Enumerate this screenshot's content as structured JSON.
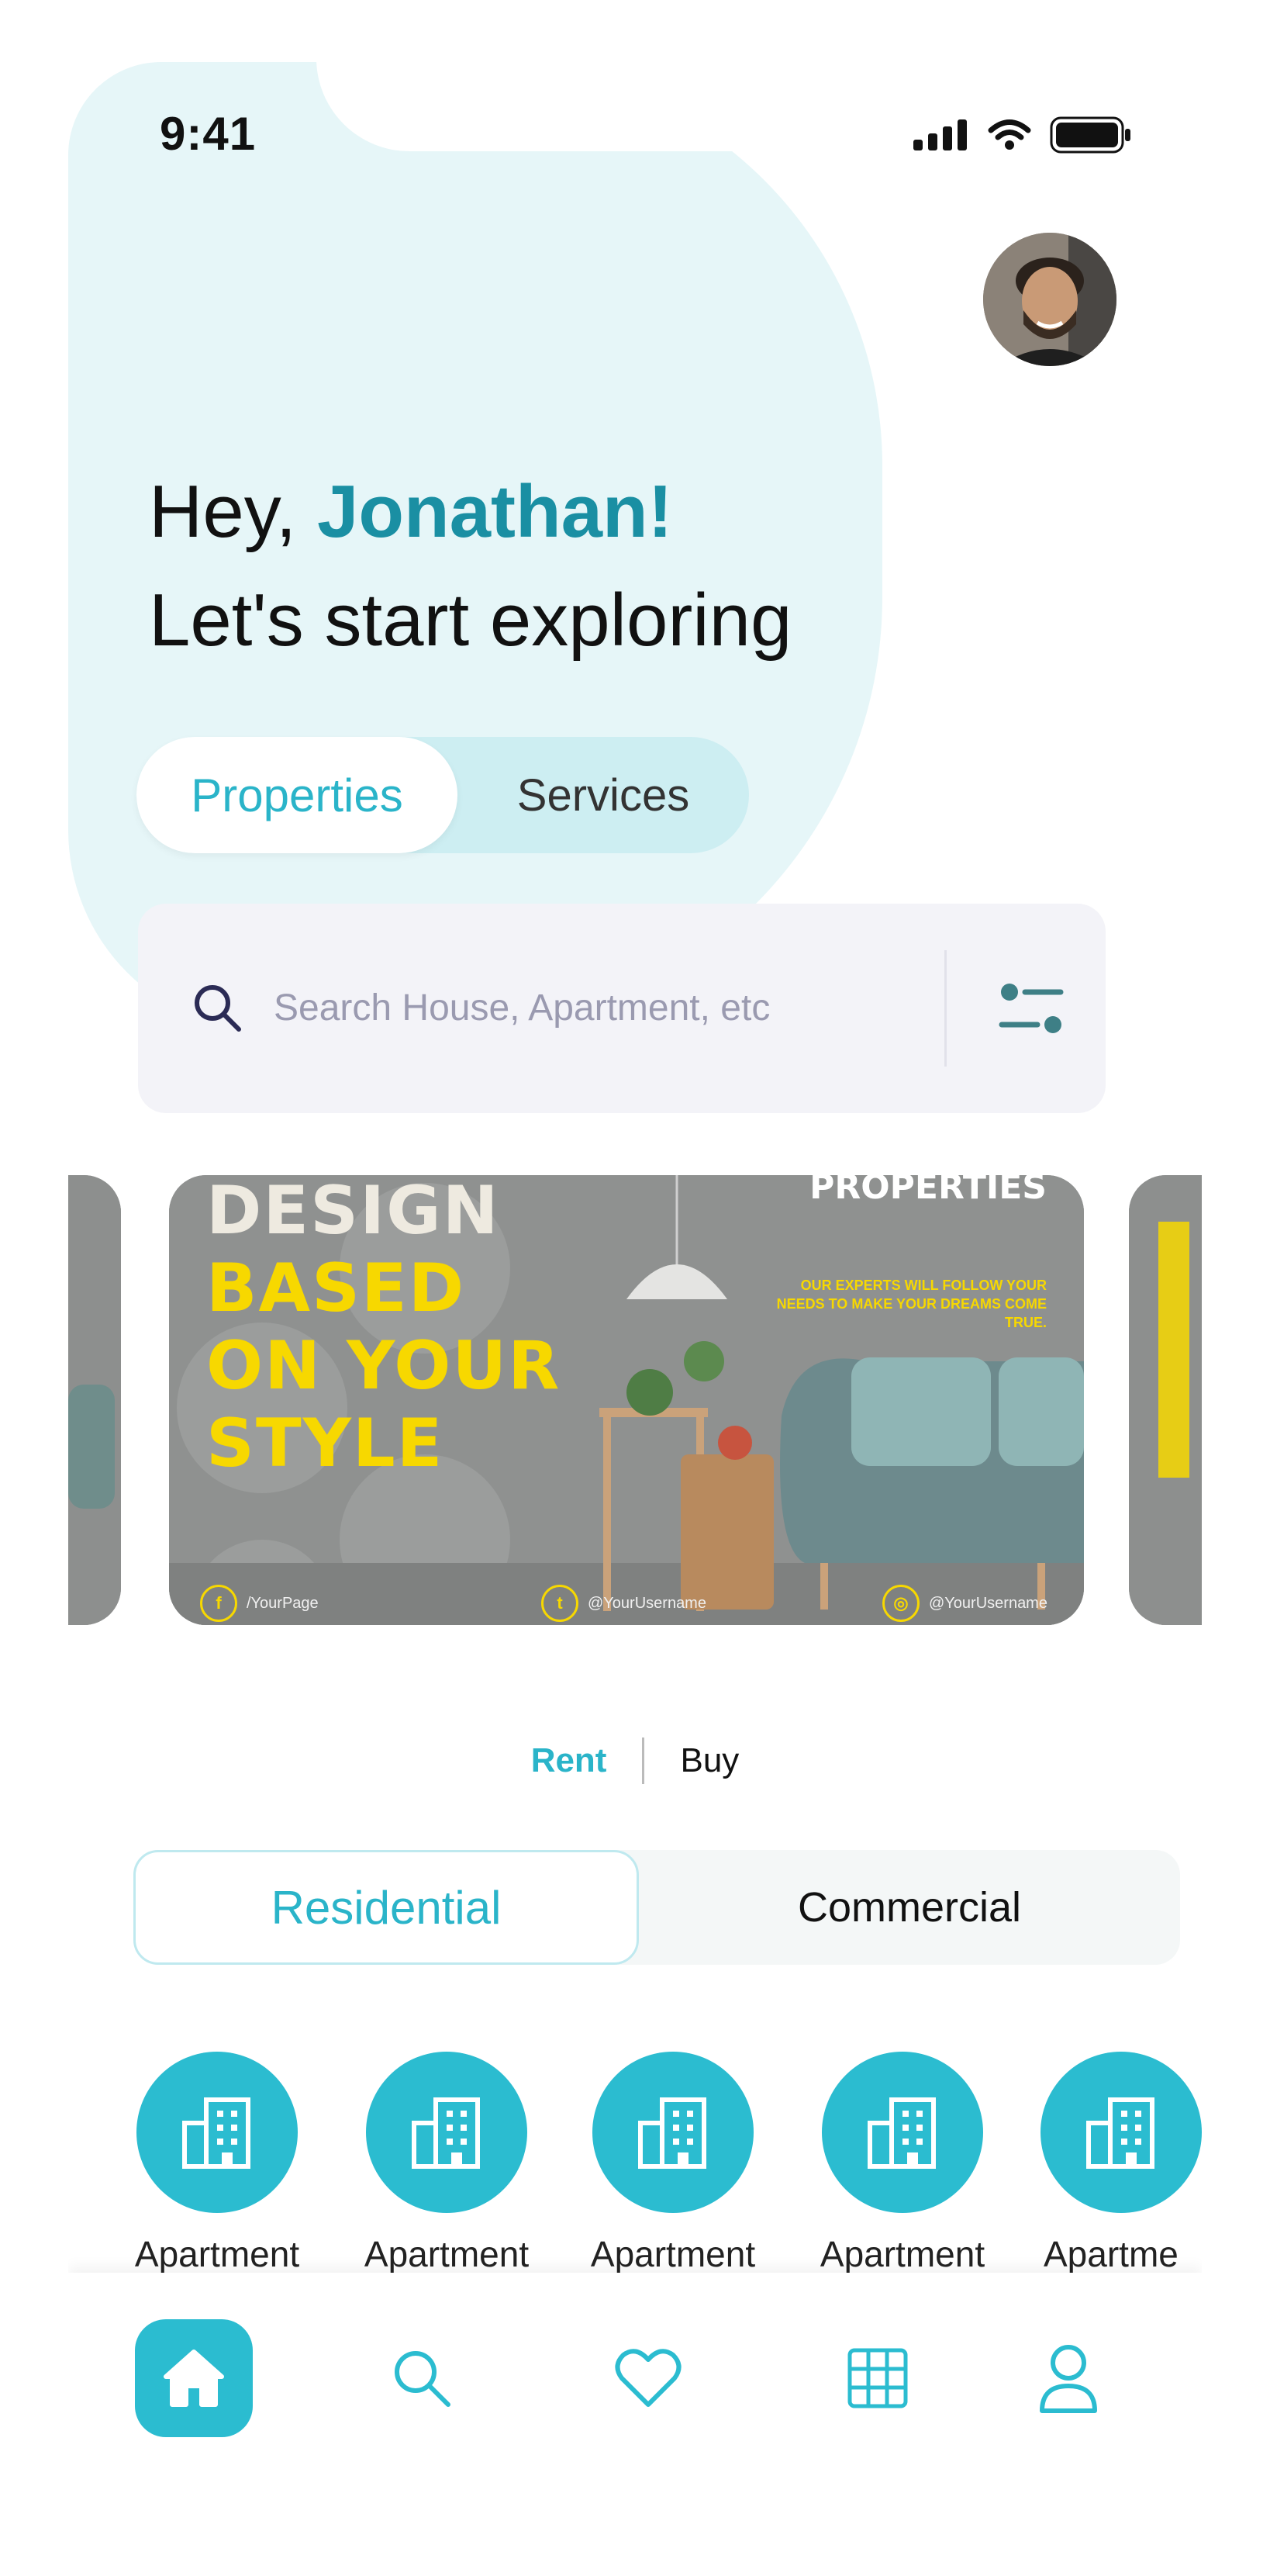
{
  "status_bar": {
    "time": "9:41"
  },
  "greeting": {
    "prefix": "Hey, ",
    "name": "Jonathan!",
    "subtitle": "Let's start exploring"
  },
  "main_tabs": {
    "active": "Properties",
    "inactive": "Services"
  },
  "search": {
    "placeholder": "Search House, Apartment, etc"
  },
  "banner": {
    "line1": "DESIGN",
    "line2": "BASED",
    "line3": "ON YOUR",
    "line4": "STYLE",
    "top_text": "PROPERTIES",
    "subtext": "OUR EXPERTS WILL FOLLOW YOUR NEEDS TO MAKE YOUR DREAMS COME TRUE.",
    "social": [
      {
        "icon": "facebook-icon",
        "glyph": "f",
        "handle": "/YourPage"
      },
      {
        "icon": "twitter-icon",
        "glyph": "t",
        "handle": "@YourUsername"
      },
      {
        "icon": "instagram-icon",
        "glyph": "◎",
        "handle": "@YourUsername"
      }
    ]
  },
  "listing_mode": {
    "rent": "Rent",
    "buy": "Buy"
  },
  "category_tabs": {
    "active": "Residential",
    "inactive": "Commercial"
  },
  "property_types": [
    {
      "label": "Apartment",
      "icon": "building-icon"
    },
    {
      "label": "Apartment",
      "icon": "building-icon"
    },
    {
      "label": "Apartment",
      "icon": "building-icon"
    },
    {
      "label": "Apartment",
      "icon": "building-icon"
    },
    {
      "label": "Apartme",
      "icon": "building-icon"
    }
  ],
  "tab_bar": [
    "home-icon",
    "search-icon",
    "heart-icon",
    "grid-icon",
    "profile-icon"
  ],
  "colors": {
    "accent": "#2bbcd0",
    "name": "#1a8fa3",
    "blob": "#e6f6f8",
    "banner_yellow": "#f7d800"
  }
}
